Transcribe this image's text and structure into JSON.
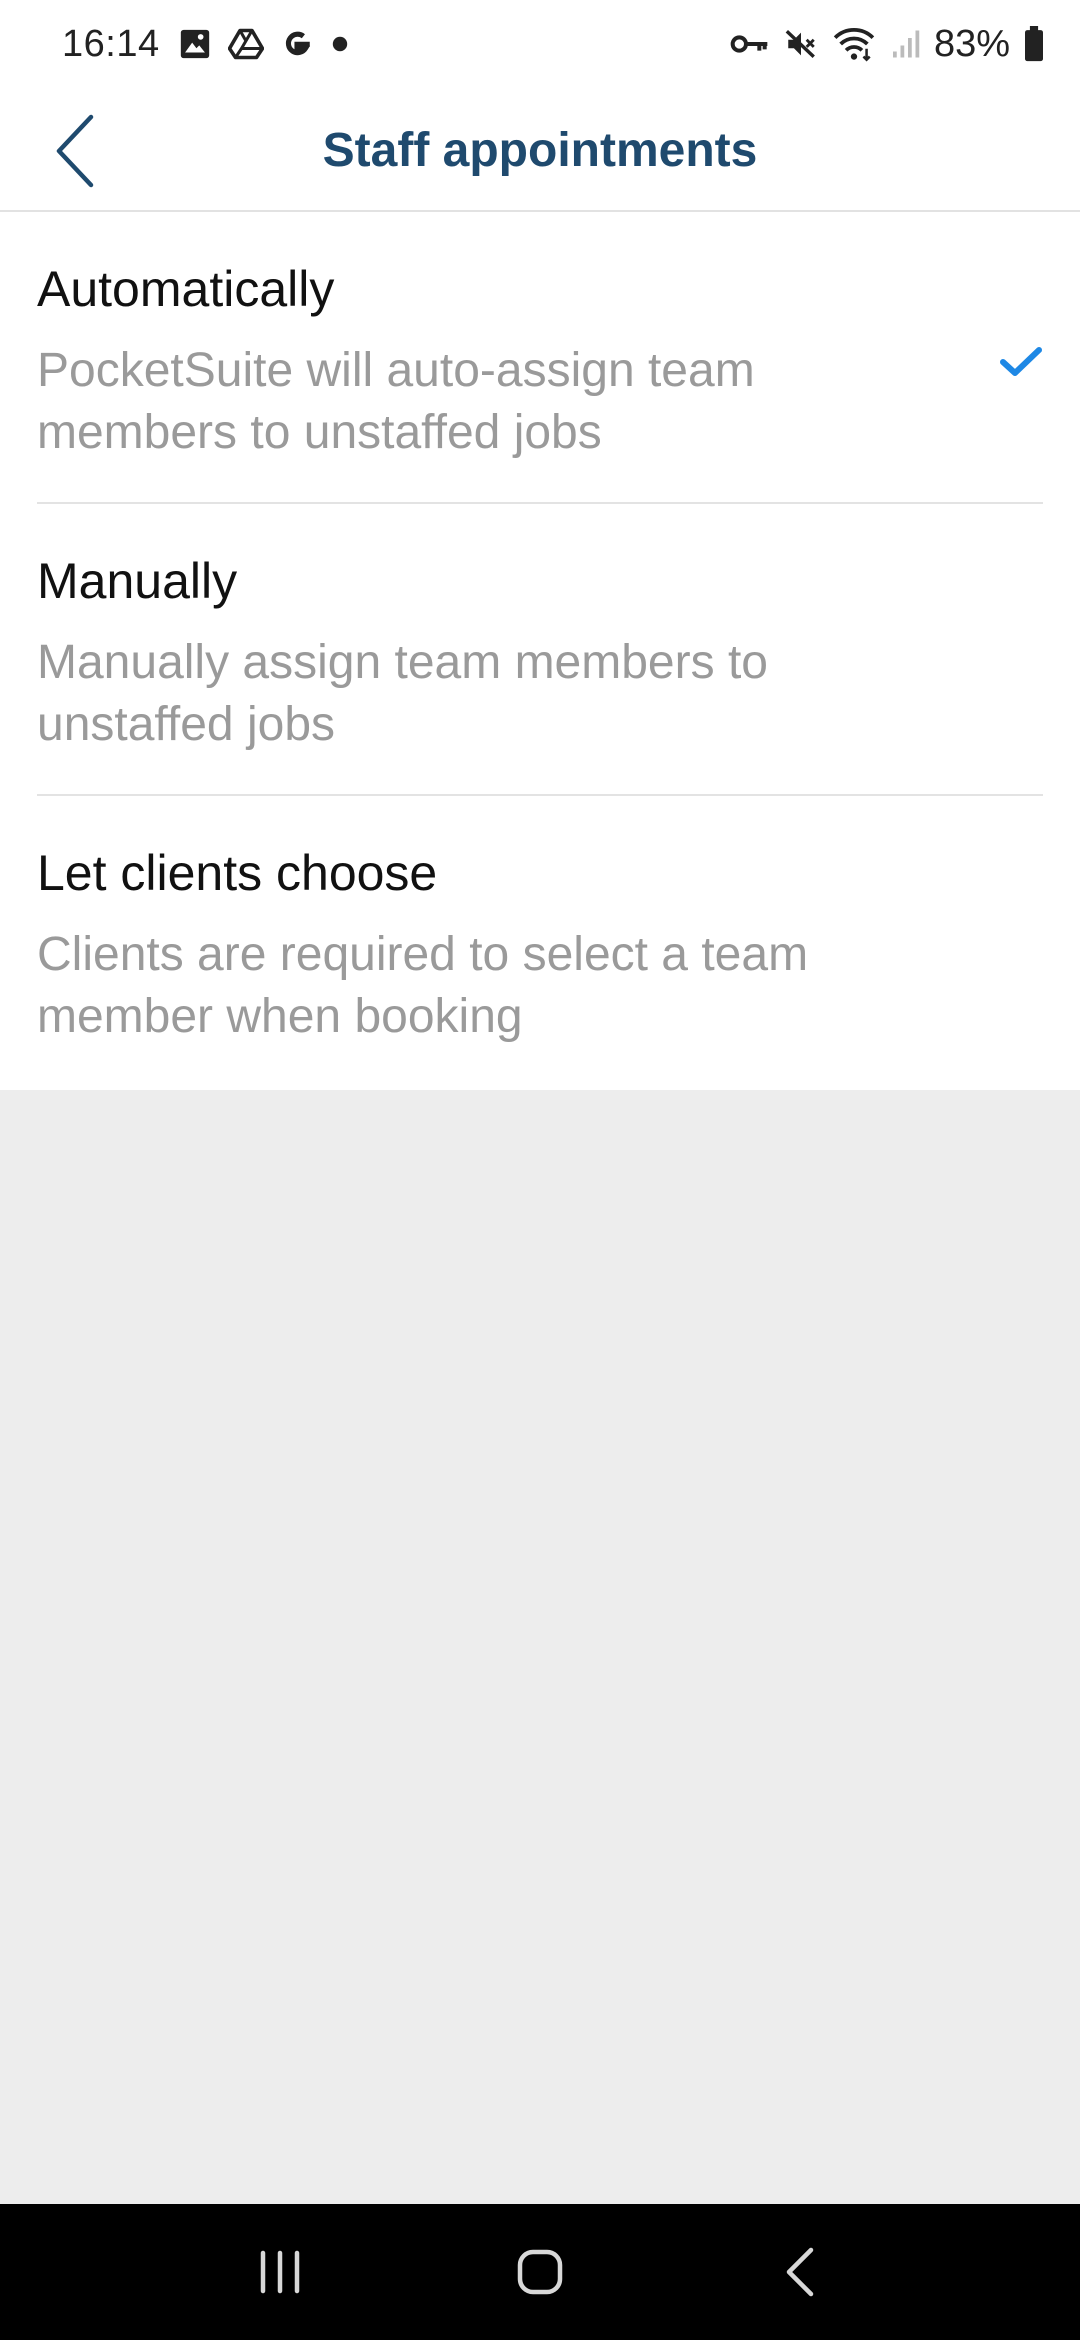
{
  "status_bar": {
    "time": "16:14",
    "battery_percent": "83%",
    "left_icons": [
      "image-icon",
      "drive-icon",
      "google-icon",
      "dot-icon"
    ],
    "right_icons": [
      "vpn-key-icon",
      "mute-icon",
      "wifi-icon",
      "signal-icon",
      "battery-icon"
    ]
  },
  "header": {
    "title": "Staff appointments"
  },
  "options": [
    {
      "title": "Automatically",
      "description": "PocketSuite will auto-assign team members to unstaffed jobs",
      "selected": true
    },
    {
      "title": "Manually",
      "description": "Manually assign team members to unstaffed jobs",
      "selected": false
    },
    {
      "title": "Let clients choose",
      "description": "Clients are required to select a team member when booking",
      "selected": false
    }
  ],
  "colors": {
    "title": "#1f4a6e",
    "check": "#1e88e5",
    "description": "#9a9a9a",
    "background": "#ededed"
  },
  "nav_bar": {
    "buttons": [
      "recents-icon",
      "home-icon",
      "back-icon"
    ]
  }
}
